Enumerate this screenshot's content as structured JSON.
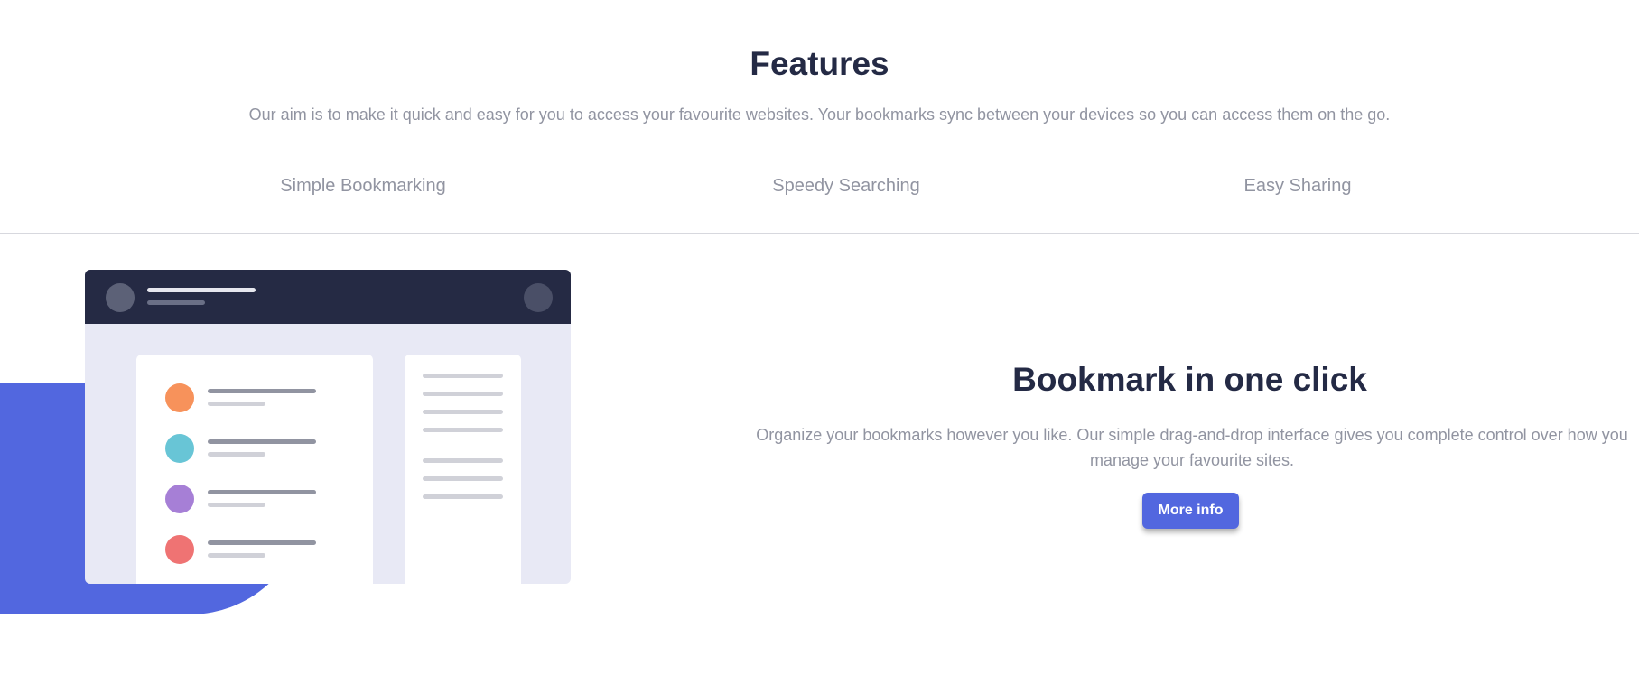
{
  "features": {
    "title": "Features",
    "subtitle": "Our aim is to make it quick and easy for you to access your favourite websites. Your bookmarks sync between your devices so you can access them on the go."
  },
  "tabs": [
    {
      "label": "Simple Bookmarking"
    },
    {
      "label": "Speedy Searching"
    },
    {
      "label": "Easy Sharing"
    }
  ],
  "content": {
    "title": "Bookmark in one click",
    "description": "Organize your bookmarks however you like. Our simple drag-and-drop interface gives you complete control over how you manage your favourite sites.",
    "button_label": "More info"
  },
  "colors": {
    "heading": "#242a45",
    "body_text": "#9194a1",
    "accent_blue": "#5267df",
    "illustration_header": "#252a44",
    "illustration_bg": "#e8e9f5",
    "bookmark_dots": [
      "#f7925b",
      "#68c5d6",
      "#a67fd6",
      "#ef7373"
    ]
  }
}
